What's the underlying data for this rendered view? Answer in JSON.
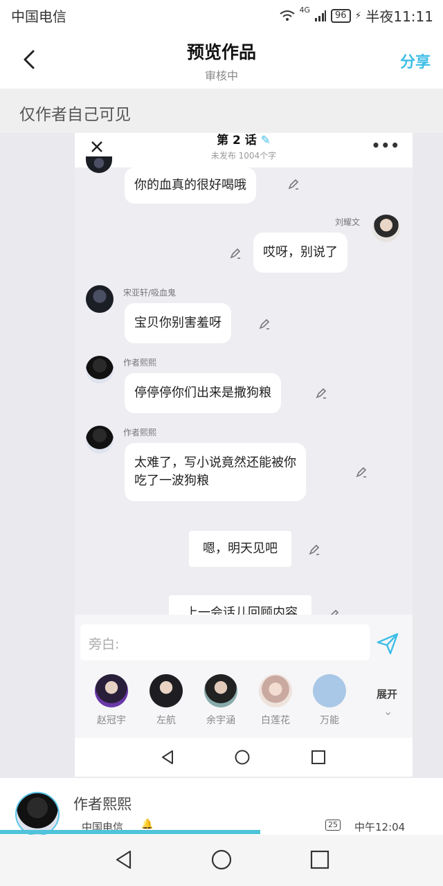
{
  "status_bar": {
    "carrier": "中国电信",
    "network": "4G",
    "battery": "96",
    "time": "半夜11:11"
  },
  "header": {
    "title": "预览作品",
    "subtitle": "审核中",
    "share_label": "分享"
  },
  "visibility_note": "仅作者自己可见",
  "chapter": {
    "title": "第 2 话",
    "meta": "未发布 1004个字"
  },
  "messages": [
    {
      "side": "left",
      "name": "",
      "text": "你的血真的很好喝哦"
    },
    {
      "side": "right",
      "name": "刘耀文",
      "text": "哎呀，别说了"
    },
    {
      "side": "left",
      "name": "宋亚轩/吸血鬼",
      "text": "宝贝你别害羞呀"
    },
    {
      "side": "left",
      "name": "作者熙熙",
      "text": "停停停你们出来是撒狗粮"
    },
    {
      "side": "left",
      "name": "作者熙熙",
      "text_line1": "太难了，写小说竟然还能被你",
      "text_line2": "吃了一波狗粮"
    },
    {
      "side": "center",
      "text": "嗯，明天见吧"
    },
    {
      "side": "center",
      "text": "上一会话儿回顾内容"
    }
  ],
  "input": {
    "placeholder": "旁白:"
  },
  "characters": [
    {
      "name": "赵冠宇"
    },
    {
      "name": "左航"
    },
    {
      "name": "余宇涵"
    },
    {
      "name": "白莲花"
    },
    {
      "name": "万能"
    }
  ],
  "expand_label": "展开",
  "author": {
    "name": "作者熙熙"
  },
  "inner_status": {
    "carrier": "中国电信",
    "battery": "25",
    "time": "中午12:04"
  },
  "colors": {
    "accent": "#3dbde8",
    "progress": "#4ec3d9"
  }
}
